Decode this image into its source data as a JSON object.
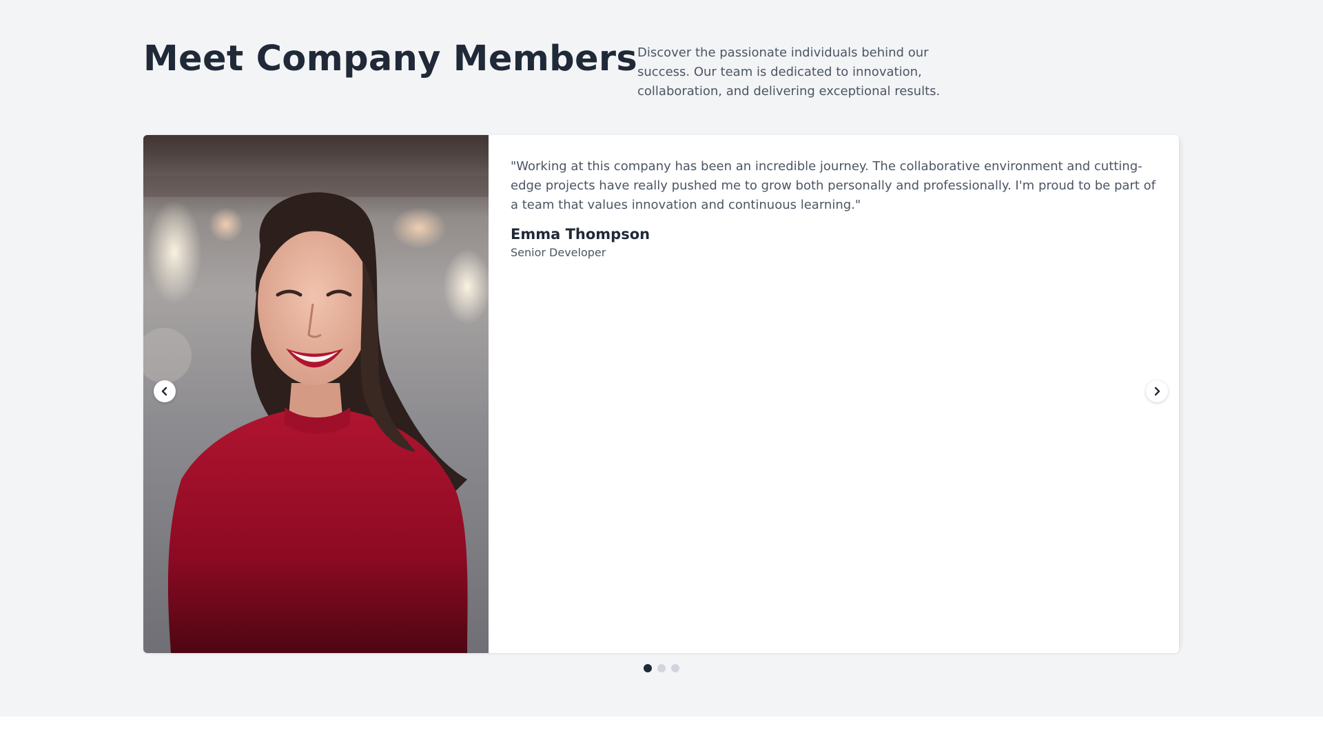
{
  "header": {
    "title": "Meet Company Members",
    "description": "Discover the passionate individuals behind our success. Our team is dedicated to innovation, collaboration, and delivering exceptional results."
  },
  "testimonial": {
    "quote": "\"Working at this company has been an incredible journey. The collaborative environment and cutting-edge projects have really pushed me to grow both personally and professionally. I'm proud to be part of a team that values innovation and continuous learning.\"",
    "name": "Emma Thompson",
    "role": "Senior Developer",
    "photo_icon": "portrait-photo"
  },
  "navigation": {
    "prev_icon": "chevron-left-icon",
    "next_icon": "chevron-right-icon"
  },
  "pagination": {
    "total": 3,
    "active_index": 0
  },
  "colors": {
    "background": "#f3f4f6",
    "heading": "#1f2937",
    "body_text": "#4b5563",
    "dot_active": "#1f2937",
    "dot_inactive": "#d1d5db",
    "sweater": "#a3102d"
  }
}
